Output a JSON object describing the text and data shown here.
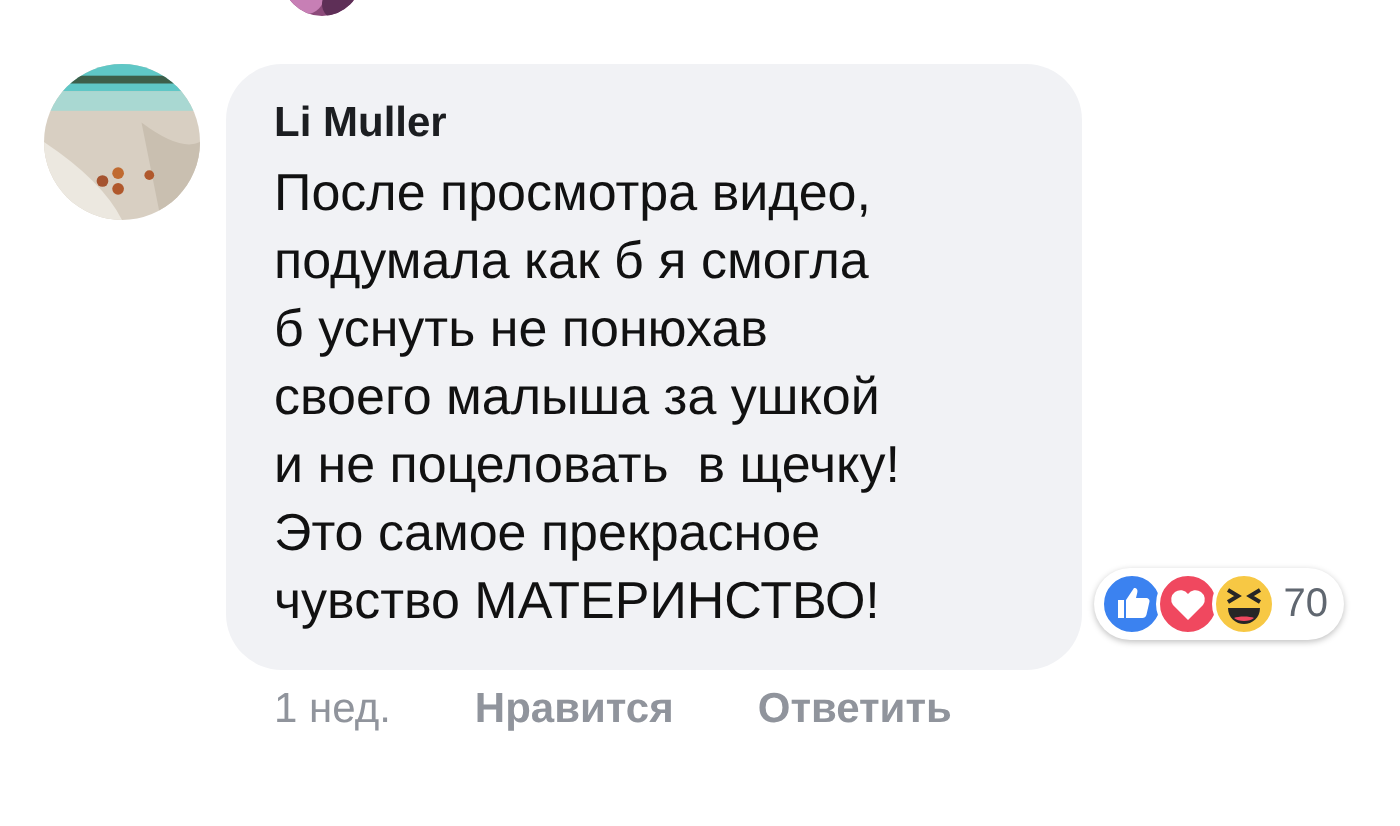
{
  "previous_comment": {
    "avatar": {
      "kind": "picture"
    }
  },
  "comment": {
    "author": "Li Muller",
    "avatar": {
      "kind": "picture"
    },
    "text": "После просмотра видео,\nподумала как б я смогла\nб уснуть не понюхав\nсвоего малыша за ушкой\nи не поцеловать  в щечку!\nЭто самое прекрасное\nчувство МАТЕРИНСТВО!",
    "reactions": [
      {
        "kind": "like"
      },
      {
        "kind": "love"
      },
      {
        "kind": "haha"
      }
    ],
    "reaction_count": "70",
    "time": "1 нед.",
    "actions": [
      "Нравится",
      "Ответить"
    ]
  }
}
